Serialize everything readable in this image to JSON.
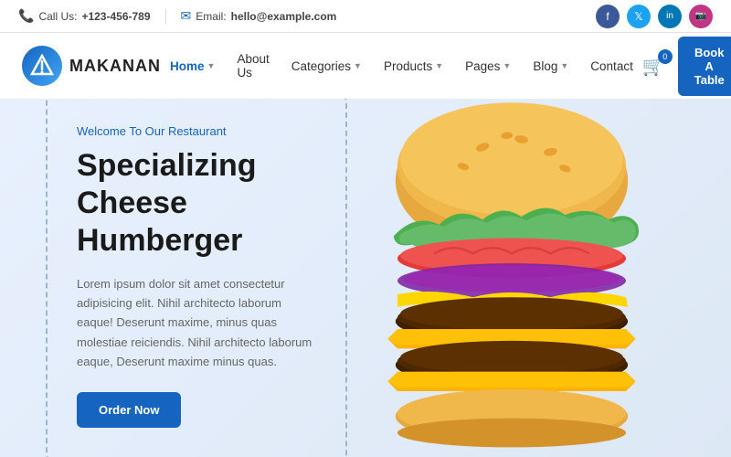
{
  "topbar": {
    "call_label": "Call Us:",
    "phone": "+123-456-789",
    "email_label": "Email:",
    "email": "hello@example.com"
  },
  "social": [
    {
      "name": "facebook",
      "label": "f",
      "class": "social-fb"
    },
    {
      "name": "twitter",
      "label": "t",
      "class": "social-tw"
    },
    {
      "name": "linkedin",
      "label": "in",
      "class": "social-li"
    },
    {
      "name": "instagram",
      "label": "ig",
      "class": "social-ig"
    }
  ],
  "header": {
    "logo_text": "MAKANAN",
    "cart_count": "0"
  },
  "nav": {
    "items": [
      {
        "label": "Home",
        "active": true,
        "has_dropdown": true
      },
      {
        "label": "About Us",
        "active": false,
        "has_dropdown": false
      },
      {
        "label": "Categories",
        "active": false,
        "has_dropdown": true
      },
      {
        "label": "Products",
        "active": false,
        "has_dropdown": true
      },
      {
        "label": "Pages",
        "active": false,
        "has_dropdown": true
      },
      {
        "label": "Blog",
        "active": false,
        "has_dropdown": true
      },
      {
        "label": "Contact",
        "active": false,
        "has_dropdown": false
      }
    ],
    "book_btn_label": "Book A Table"
  },
  "hero": {
    "welcome": "Welcome To Our Restaurant",
    "title": "Specializing Cheese Humberger",
    "description": "Lorem ipsum dolor sit amet consectetur adipisicing elit. Nihil architecto laborum eaque! Deserunt maxime, minus quas molestiae reiciendis. Nihil architecto laborum eaque, Deserunt maxime minus quas.",
    "order_btn": "Order Now"
  }
}
